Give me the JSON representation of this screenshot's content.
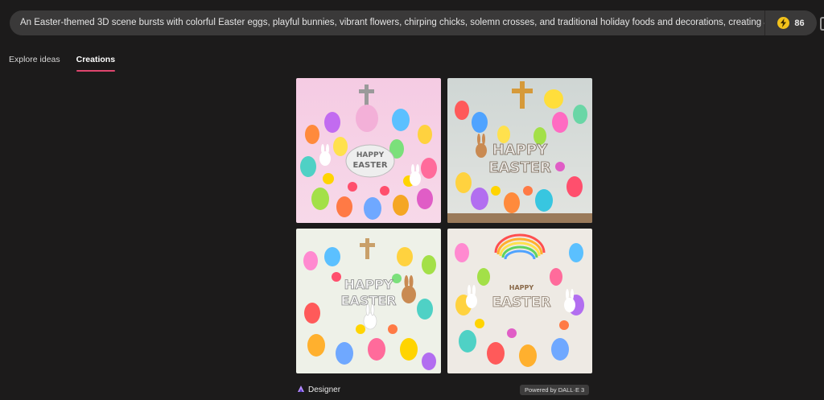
{
  "prompt": {
    "text": "An Easter-themed 3D scene bursts with colorful Easter eggs, playful bunnies, vibrant flowers, chirping chicks, solemn crosses, and traditional holiday foods and decorations, creating a joyous at",
    "boost_icon": "lightning-icon",
    "boost_count": "86"
  },
  "tabs": [
    {
      "label": "Explore ideas",
      "active": false
    },
    {
      "label": "Creations",
      "active": true
    }
  ],
  "images": [
    {
      "banner_line1": "HAPPY",
      "banner_line2": "EASTER"
    },
    {
      "banner_line1": "HAPPY",
      "banner_line2": "EASTER"
    },
    {
      "banner_line1": "HAPPY",
      "banner_line2": "EASTER"
    },
    {
      "banner_line1": "HAPPY",
      "banner_line2": "EASTER"
    }
  ],
  "footer": {
    "brand_label": "Designer",
    "brand_icon": "designer-logo-icon",
    "powered_by": "Powered by DALL·E 3"
  },
  "colors": {
    "background": "#1c1b1b",
    "prompt_bar": "#3a3939",
    "tab_underline": "#e0466e",
    "boost": "#f2c21b"
  }
}
